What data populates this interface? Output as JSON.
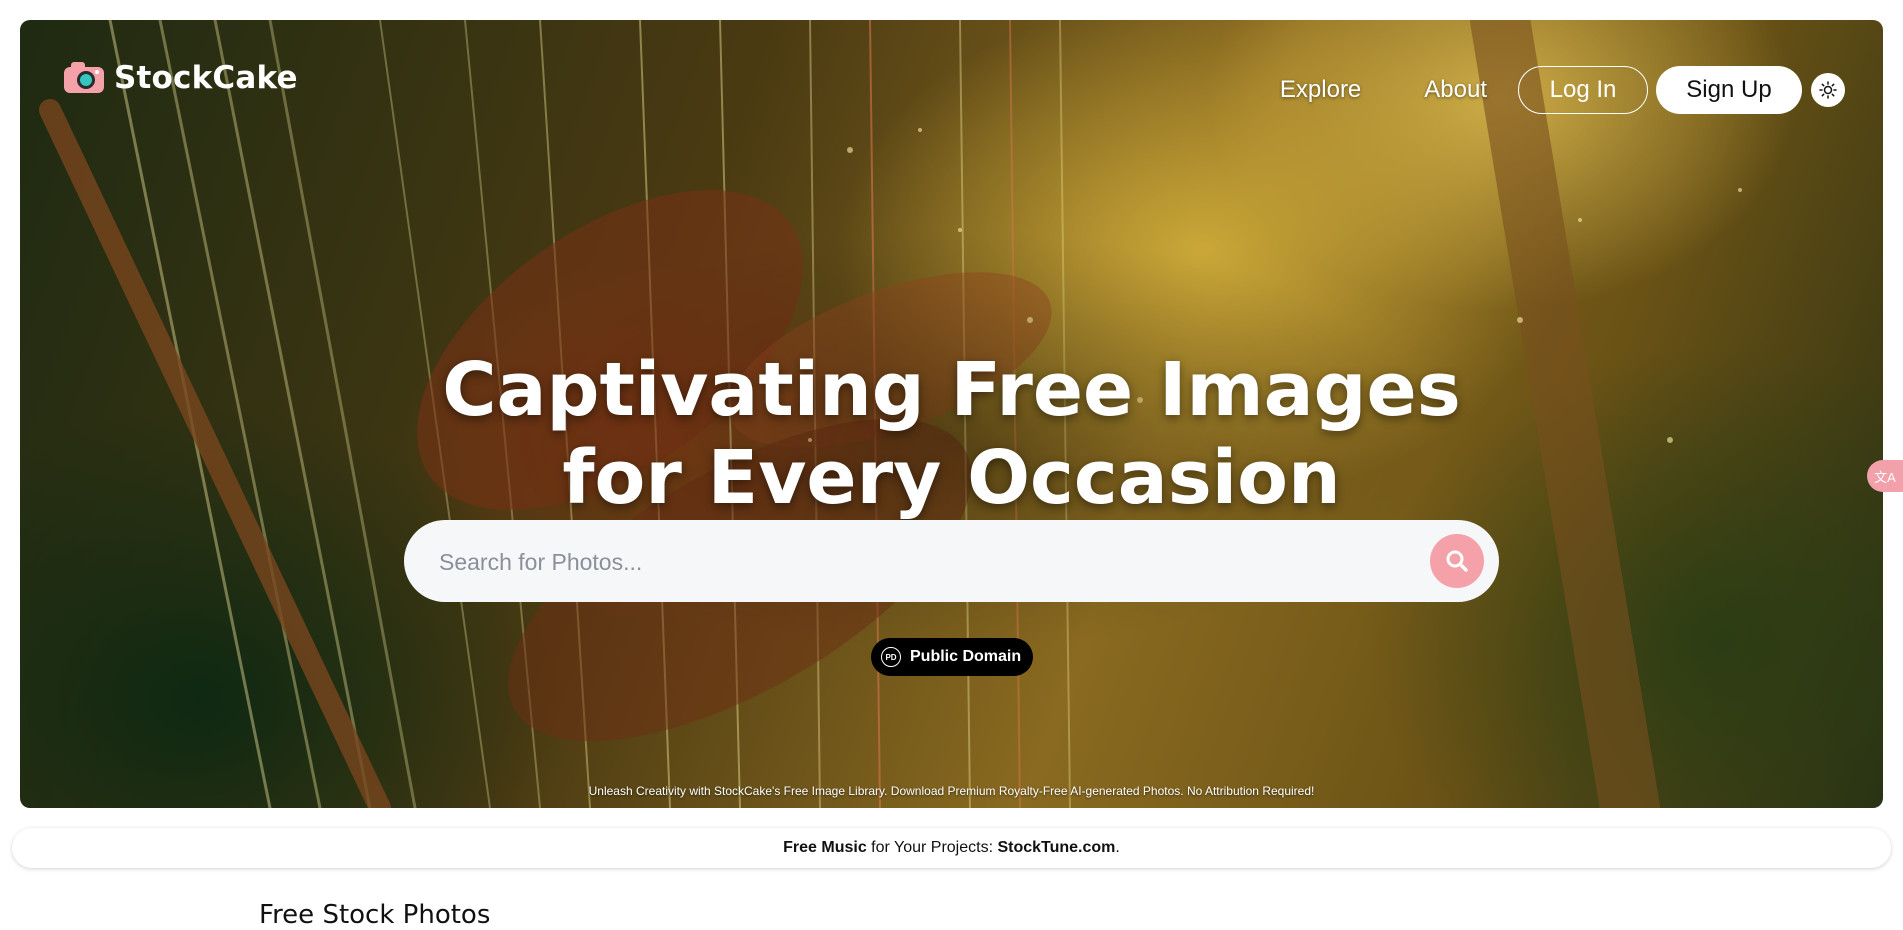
{
  "brand": {
    "name": "StockCake"
  },
  "nav": {
    "explore": "Explore",
    "about": "About",
    "login": "Log In",
    "signup": "Sign Up",
    "theme_icon": "sun-icon"
  },
  "hero": {
    "headline_line1": "Captivating Free Images",
    "headline_line2": "for Every Occasion",
    "search_placeholder": "Search for Photos...",
    "badge_icon_text": "PD",
    "badge_label": "Public Domain",
    "tagline": "Unleash Creativity with StockCake's Free Image Library. Download Premium Royalty-Free AI-generated Photos. No Attribution Required!"
  },
  "promo": {
    "bold1": "Free Music",
    "text": " for Your Projects: ",
    "bold2": "StockTune.com",
    "end": "."
  },
  "section": {
    "title": "Free Stock Photos"
  },
  "colors": {
    "accent_pink": "#f4a1aa",
    "dark": "#000000"
  }
}
